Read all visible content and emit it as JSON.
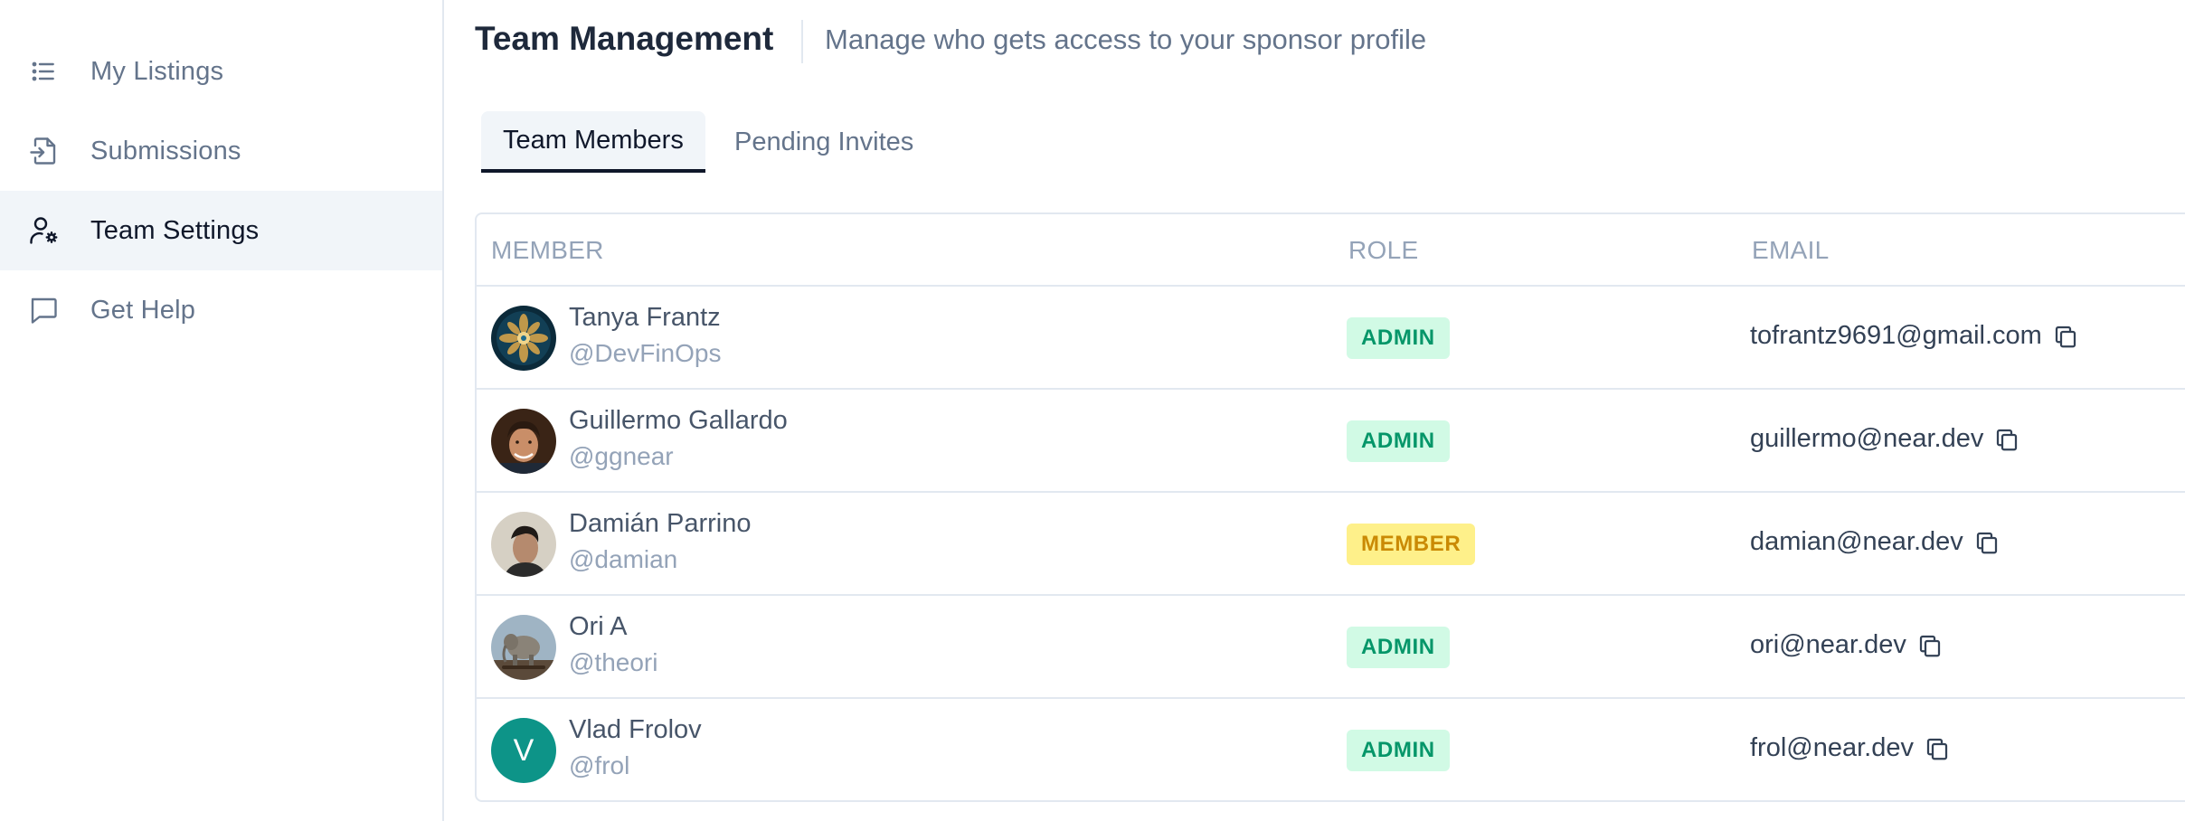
{
  "sidebar": {
    "items": [
      {
        "label": "My Listings",
        "icon": "list-icon",
        "active": false
      },
      {
        "label": "Submissions",
        "icon": "file-import-icon",
        "active": false
      },
      {
        "label": "Team Settings",
        "icon": "user-gear-icon",
        "active": true
      },
      {
        "label": "Get Help",
        "icon": "chat-bubble-icon",
        "active": false
      }
    ]
  },
  "header": {
    "title": "Team Management",
    "subtitle": "Manage who gets access to your sponsor profile"
  },
  "tabs": [
    {
      "label": "Team Members",
      "active": true
    },
    {
      "label": "Pending Invites",
      "active": false
    }
  ],
  "table": {
    "headers": {
      "member": "MEMBER",
      "role": "ROLE",
      "email": "EMAIL"
    },
    "rows": [
      {
        "name": "Tanya Frantz",
        "handle": "@DevFinOps",
        "role": "ADMIN",
        "email": "tofrantz9691@gmail.com"
      },
      {
        "name": "Guillermo Gallardo",
        "handle": "@ggnear",
        "role": "ADMIN",
        "email": "guillermo@near.dev"
      },
      {
        "name": "Damián Parrino",
        "handle": "@damian",
        "role": "MEMBER",
        "email": "damian@near.dev"
      },
      {
        "name": "Ori A",
        "handle": "@theori",
        "role": "ADMIN",
        "email": "ori@near.dev"
      },
      {
        "name": "Vlad Frolov",
        "handle": "@frol",
        "role": "ADMIN",
        "email": "frol@near.dev",
        "avatar_letter": "V"
      }
    ]
  },
  "colors": {
    "admin_bg": "#d1fae5",
    "admin_text": "#059669",
    "member_bg": "#fef08a",
    "member_text": "#ca8a04",
    "avatar_teal": "#0d9488"
  }
}
